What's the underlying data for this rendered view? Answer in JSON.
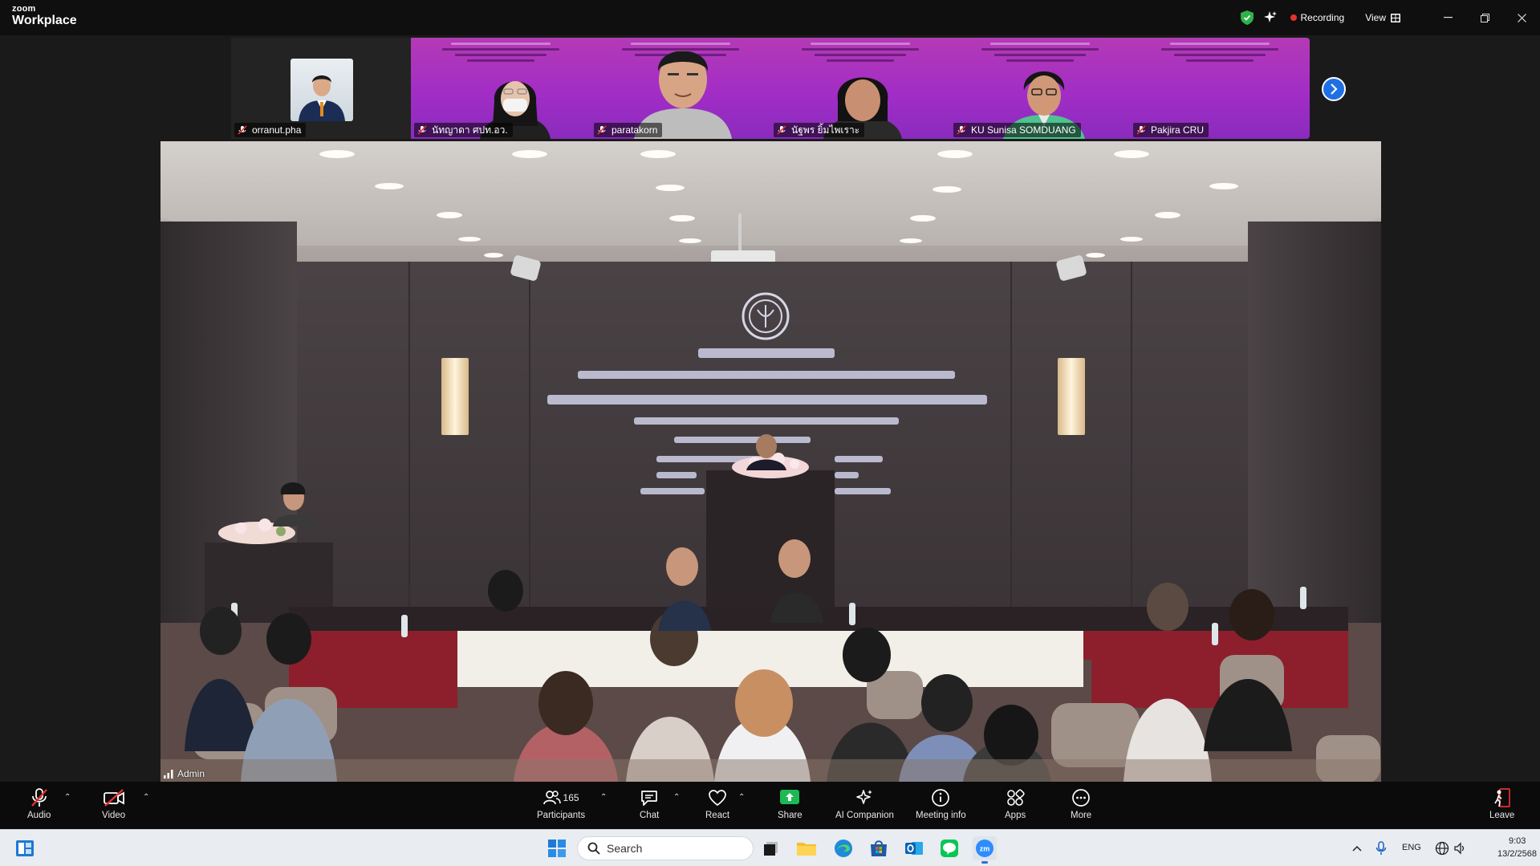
{
  "app": {
    "brand_small": "zoom",
    "brand_large": "Workplace"
  },
  "titlebar": {
    "recording_label": "Recording",
    "view_label": "View"
  },
  "gallery": {
    "tiles": [
      {
        "name": "orranut.pha",
        "style": "photo"
      },
      {
        "name": "นัทญาดา ศปท.อว.",
        "style": "purple"
      },
      {
        "name": "paratakorn",
        "style": "purple"
      },
      {
        "name": "นัฐพร ยิ้มไพเราะ",
        "style": "purple"
      },
      {
        "name": "KU Sunisa SOMDUANG",
        "style": "purple"
      },
      {
        "name": "Pakjira CRU",
        "style": "purple"
      }
    ]
  },
  "main_video": {
    "speaker_name": "Admin"
  },
  "toolbar": {
    "audio": "Audio",
    "video": "Video",
    "participants": "Participants",
    "participants_count": "165",
    "chat": "Chat",
    "react": "React",
    "share": "Share",
    "ai_companion": "AI Companion",
    "meeting_info": "Meeting info",
    "apps": "Apps",
    "more": "More",
    "leave": "Leave"
  },
  "taskbar": {
    "search_placeholder": "Search",
    "language": "ENG",
    "time": "9:03",
    "date": "13/2/2568"
  },
  "colors": {
    "accent_blue": "#1f6fe5",
    "recording_red": "#e5322d",
    "share_green": "#1db954",
    "tile_purple": "#a22dc6",
    "secure_green": "#2fb24a"
  }
}
